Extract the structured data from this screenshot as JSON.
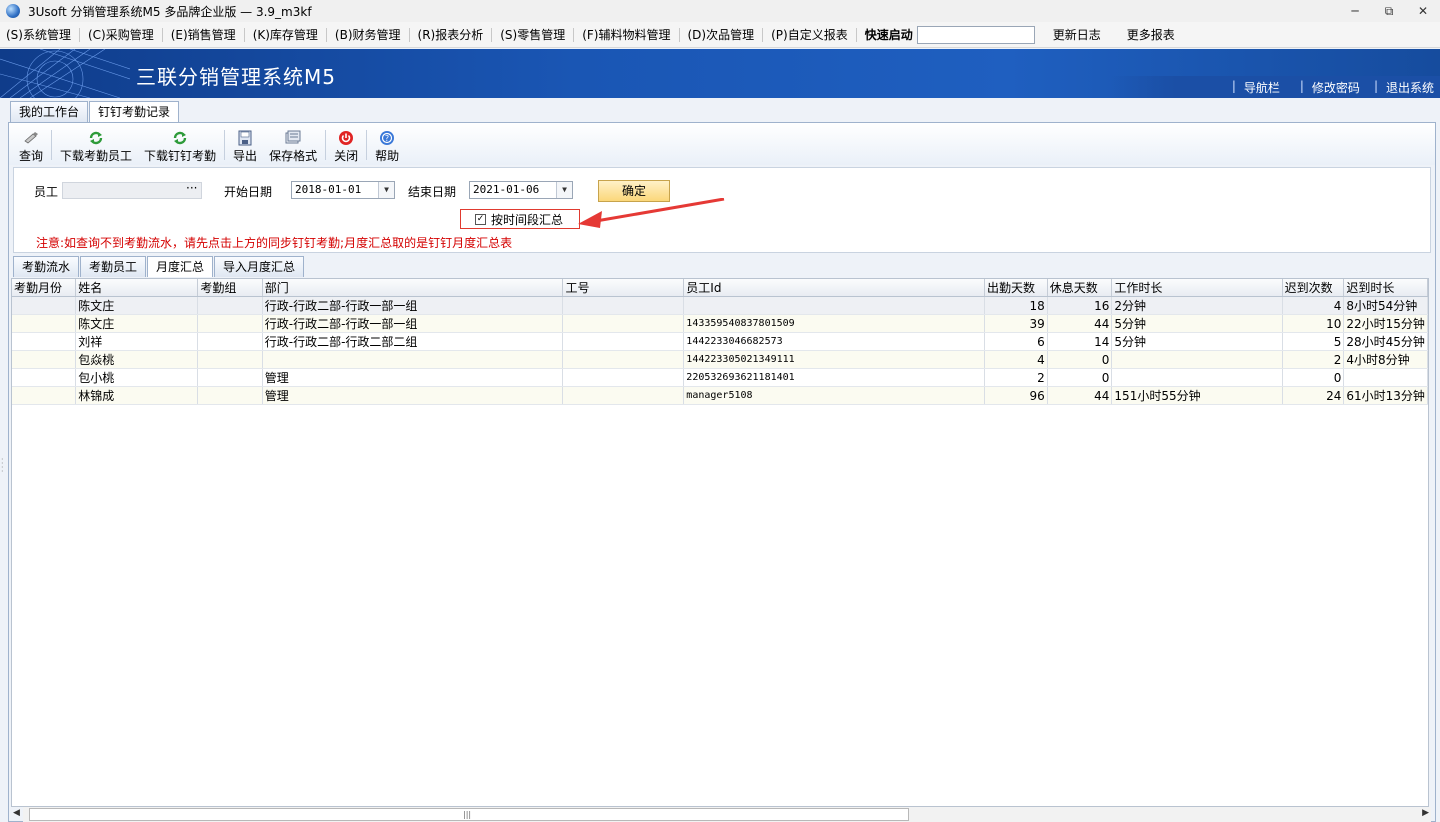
{
  "window": {
    "title": "3Usoft 分销管理系统M5 多品牌企业版 — 3.9_m3kf",
    "minimize": "─",
    "restore": "⧉",
    "close": "✕"
  },
  "menu": {
    "items": [
      "(S)系统管理",
      "(C)采购管理",
      "(E)销售管理",
      "(K)库存管理",
      "(B)财务管理",
      "(R)报表分析",
      "(S)零售管理",
      "(F)辅料物料管理",
      "(D)次品管理",
      "(P)自定义报表"
    ],
    "quick_label": "快速启动",
    "quick_value": "",
    "update_log": "更新日志",
    "more_reports": "更多报表"
  },
  "banner": {
    "app_name": "三联分销管理系统M5",
    "links": [
      "导航栏",
      "修改密码",
      "退出系统"
    ]
  },
  "doc_tabs": [
    "我的工作台",
    "钉钉考勤记录"
  ],
  "toolbar": {
    "query": "查询",
    "download_staff": "下载考勤员工",
    "download_dingtalk": "下载钉钉考勤",
    "export": "导出",
    "save_format": "保存格式",
    "close": "关闭",
    "help": "帮助"
  },
  "filter": {
    "employee_label": "员工",
    "employee_value": "",
    "employee_ellipsis": "···",
    "start_label": "开始日期",
    "start_value": "2018-01-01",
    "end_label": "结束日期",
    "end_value": "2021-01-06",
    "ok": "确定",
    "checkbox_label": "按时间段汇总",
    "checkbox_mark": "✓",
    "notice": "注意:如查询不到考勤流水，请先点击上方的同步钉钉考勤;月度汇总取的是钉钉月度汇总表"
  },
  "sub_tabs": [
    "考勤流水",
    "考勤员工",
    "月度汇总",
    "导入月度汇总"
  ],
  "grid": {
    "columns": [
      "考勤月份",
      "姓名",
      "考勤组",
      "部门",
      "工号",
      "员工Id",
      "出勤天数",
      "休息天数",
      "工作时长",
      "迟到次数",
      "迟到时长"
    ],
    "rows": [
      [
        "",
        "陈文庄",
        "",
        "行政-行政二部-行政一部一组",
        "",
        "",
        "18",
        "16",
        "2分钟",
        "4",
        "8小时54分钟"
      ],
      [
        "",
        "陈文庄",
        "",
        "行政-行政二部-行政一部一组",
        "",
        "143359540837801509",
        "39",
        "44",
        "5分钟",
        "10",
        "22小时15分钟"
      ],
      [
        "",
        "刘祥",
        "",
        "行政-行政二部-行政二部二组",
        "",
        "1442233046682573",
        "6",
        "14",
        "5分钟",
        "5",
        "28小时45分钟"
      ],
      [
        "",
        "包焱桃",
        "",
        "",
        "",
        "144223305021349111",
        "4",
        "0",
        "",
        "2",
        "4小时8分钟"
      ],
      [
        "",
        "包小桃",
        "",
        "管理",
        "",
        "220532693621181401",
        "2",
        "0",
        "",
        "0",
        ""
      ],
      [
        "",
        "林锦成",
        "",
        "管理",
        "",
        "manager5108",
        "96",
        "44",
        "151小时55分钟",
        "24",
        "61小时13分钟"
      ]
    ]
  },
  "scrollbar": {
    "left": "◀",
    "right": "▶",
    "grip": "|||"
  },
  "colors": {
    "banner": "#1a56b4",
    "notice": "#d40000",
    "highlight": "#e03a2f",
    "ok_button": "#fbd77a"
  }
}
